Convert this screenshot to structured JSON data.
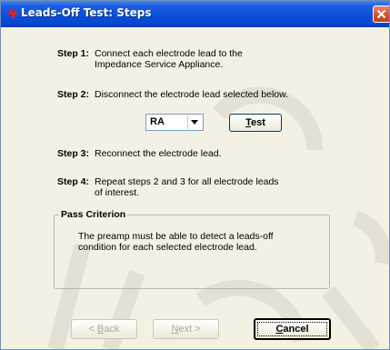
{
  "window": {
    "title": "Leads-Off Test:  Steps",
    "icons": {
      "app": "app-icon",
      "close": "close-icon"
    }
  },
  "steps": [
    {
      "label": "Step 1:",
      "lines": [
        "Connect each electrode lead to the",
        "Impedance Service Appliance."
      ]
    },
    {
      "label": "Step 2:",
      "lines": [
        "Disconnect the electrode lead selected below."
      ]
    },
    {
      "label": "Step 3:",
      "lines": [
        "Reconnect the electrode lead."
      ]
    },
    {
      "label": "Step 4:",
      "lines": [
        "Repeat steps 2 and 3 for all electrode leads",
        "of interest."
      ]
    }
  ],
  "electrode_select": {
    "value": "RA"
  },
  "test_button": {
    "label_ul": "T",
    "label_rest": "est"
  },
  "pass_criterion": {
    "title": "Pass Criterion",
    "lines": [
      "The preamp must be able to detect a leads-off",
      "condition for each selected electrode lead."
    ]
  },
  "footer": {
    "back": {
      "prefix": "< ",
      "ul": "B",
      "rest": "ack"
    },
    "next": {
      "ul": "N",
      "rest": "ext >"
    },
    "cancel": {
      "ul": "C",
      "rest": "ancel"
    }
  }
}
